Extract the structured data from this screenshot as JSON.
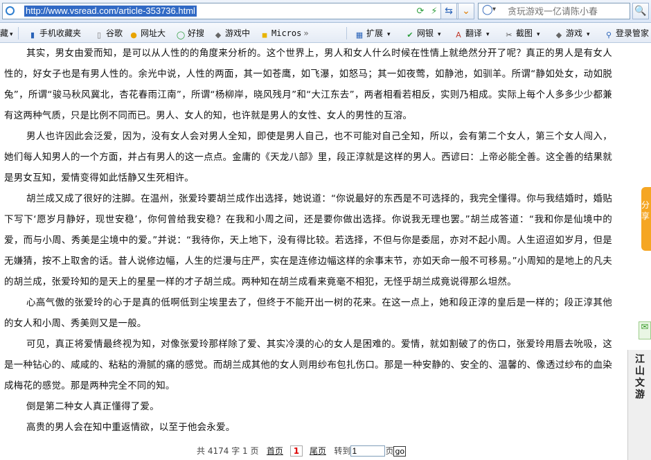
{
  "address_bar": {
    "url": "http://www.vsread.com/article-353736.html",
    "search_placeholder": "贪玩游戏一亿请陈小春"
  },
  "bookmarks": [
    {
      "label": "藏",
      "icon": "chevron-down-icon"
    },
    {
      "label": "手机收藏夹",
      "icon": "phone-icon"
    },
    {
      "label": "谷歌",
      "icon": "page-icon"
    },
    {
      "label": "网址大",
      "icon": "globe-icon"
    },
    {
      "label": "好搜",
      "icon": "search-ring-icon"
    },
    {
      "label": "游戏中",
      "icon": "gamepad-icon"
    },
    {
      "label": "Micros",
      "icon": "folder-icon"
    },
    {
      "label": "扩展",
      "icon": "extension-icon"
    },
    {
      "label": "网银",
      "icon": "shield-icon"
    },
    {
      "label": "翻译",
      "icon": "translate-icon"
    },
    {
      "label": "截图",
      "icon": "scissors-icon"
    },
    {
      "label": "游戏",
      "icon": "gamepad-icon"
    },
    {
      "label": "登录管家",
      "icon": "key-icon"
    }
  ],
  "article": {
    "paragraphs": [
      "其实，男女由爱而知，是可以从人性的的角度来分析的。这个世界上，男人和女人什么时候在性情上就绝然分开了呢？真正的男人是有女人性的，好女子也是有男人性的。余光中说，人性的两面，其一如苍鹰，如飞瀑，如怒马；其一如夜莺，如静池，如驯羊。所谓“静如处女，动如脱兔”，所谓“骏马秋风冀北，杏花春雨江南”，所谓“杨柳岸，晓风残月”和“大江东去”，两者相看若相反，实则乃相成。实际上每个人多多少少都兼有这两种气质，只是比例不同而已。男人、女人的知，也许就是男人的女性、女人的男性的互溶。",
      "男人也许因此会泛爱，因为，没有女人会对男人全知，即使是男人自己，也不可能对自己全知，所以，会有第二个女人，第三个女人闯入，她们每人知男人的一个方面，并占有男人的这一点点。金庸的《天龙八部》里，段正淳就是这样的男人。西谚曰：上帝必能全善。这全善的结果就是男女互知，爱情变得如此恬静又生死相许。",
      "胡兰成又成了很好的注脚。在温州，张爱玲要胡兰成作出选择，她说道：“你说最好的东西是不可选择的，我完全懂得。你与我结婚时，婚贴下写下‘愿岁月静好，现世安稳’，你何曾给我安稳？在我和小周之间，还是要你做出选择。你说我无理也罢。”胡兰成答道：“我和你是仙境中的爱，而与小周、秀美是尘境中的爱。”并说：“我待你，天上地下，没有得比较。若选择，不但与你是委屈，亦对不起小周。人生迢迢如岁月，但是无嫌猜，按不上取舍的话。昔人说修边幅，人生的烂漫与庄严，实在是连修边幅这样的余事末节，亦如天命一般不可移易。”小周知的是地上的凡夫的胡兰成，张爱玲知的是天上的星星一样的才子胡兰成。两种知在胡兰成看来竟毫不相犯，无怪乎胡兰成竟说得那么坦然。",
      "心高气傲的张爱玲的心于是真的低啊低到尘埃里去了，但终于不能开出一树的花来。在这一点上，她和段正淳的皇后是一样的；段正淳其他的女人和小周、秀美则又是一般。",
      "可见，真正将爱情最终视为知，对像张爱玲那样除了爱、其实冷漠的心的女人是困难的。爱情，就如割破了的伤口，张爱玲用唇去吮吸，这是一种钻心的、咸咸的、粘粘的滑腻的痛的感觉。而胡兰成其他的女人则用纱布包扎伤口。那是一种安静的、安全的、温馨的、像透过纱布的血染成梅花的感觉。那是两种完全不同的知。",
      "倒是第二种女人真正懂得了爱。",
      "高贵的男人会在知中重返情欲，以至于他会永爱。"
    ]
  },
  "pager": {
    "total_prefix": "共 ",
    "word_count": "4174",
    "total_suffix": " 字 1 页",
    "first": "首页",
    "current": "1",
    "last": "尾页",
    "goto_label": "转到",
    "goto_value": "1",
    "page_suffix": "页",
    "go": "go"
  },
  "side": {
    "orange_tab": "分享",
    "jiangshan": "江山文游"
  },
  "colors": {
    "selection": "#316ac5",
    "orange": "#f5a623",
    "link": "#222222"
  }
}
